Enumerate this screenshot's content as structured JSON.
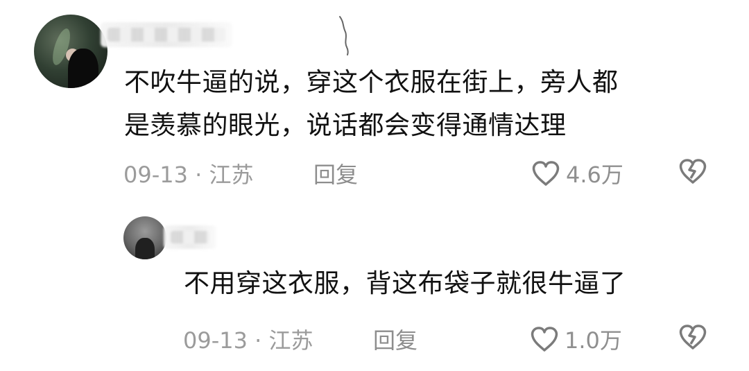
{
  "comments": [
    {
      "text_lines": [
        "不吹牛逼的说，穿这个衣服在街上，旁人都",
        "是羡慕的眼光，说话都会变得通情达理"
      ],
      "meta": "09-13 · 江苏",
      "reply_label": "回复",
      "likes": "4.6万"
    },
    {
      "text": "不用穿这衣服，背这布袋子就很牛逼了",
      "meta": "09-13 · 江苏",
      "reply_label": "回复",
      "likes": "1.0万"
    }
  ],
  "icons": {
    "like": "heart-outline-icon",
    "dislike": "broken-heart-icon"
  },
  "colors": {
    "text": "#111111",
    "meta": "#9b9b9b",
    "icon": "#7b7b7b",
    "background": "#ffffff"
  }
}
